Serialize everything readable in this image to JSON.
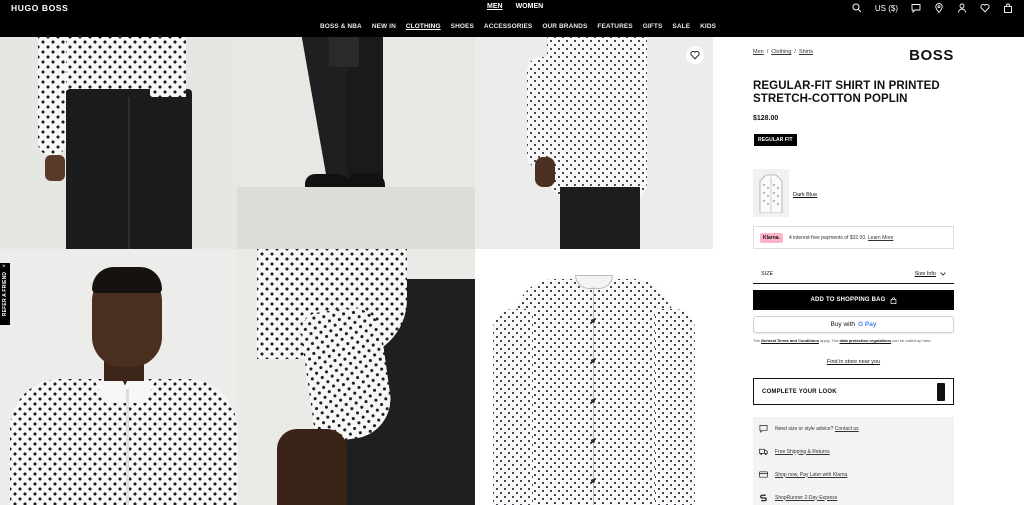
{
  "header": {
    "logo": "HUGO BOSS",
    "gender_tabs": [
      "MEN",
      "WOMEN"
    ],
    "nav": [
      "BOSS & NBA",
      "NEW IN",
      "CLOTHING",
      "SHOES",
      "ACCESSORIES",
      "OUR BRANDS",
      "FEATURES",
      "GIFTS",
      "SALE",
      "KIDS"
    ],
    "currency": "US ($)",
    "icons": [
      "search-icon",
      "chat-icon",
      "location-icon",
      "account-icon",
      "wishlist-icon",
      "bag-icon"
    ]
  },
  "refer_a_friend": "REFER A FRIEND",
  "product": {
    "breadcrumb": [
      "Men",
      "Clothing",
      "Shirts"
    ],
    "brand": "BOSS",
    "title": "REGULAR-FIT SHIRT IN PRINTED STRETCH-COTTON POPLIN",
    "price": "$128.00",
    "fit_badge": "REGULAR FIT",
    "color": "Dark Blue",
    "klarna": {
      "badge": "Klarna.",
      "text": "4 interest-free payments of $32.00.",
      "link": "Learn More"
    },
    "size_label": "SIZE",
    "size_info": "Size Info",
    "add_to_bag": "ADD TO SHOPPING BAG",
    "gpay_prefix": "Buy with",
    "gpay_brand": "G Pay",
    "legal": {
      "prefix": "The",
      "terms": "General Terms and Conditions",
      "middle": "apply. The",
      "privacy": "data protection regulations",
      "suffix": "can be called up here."
    },
    "find_in_store": "Find in store near you",
    "complete_look": "COMPLETE YOUR LOOK",
    "services": {
      "advice_text": "Need size or style advice?",
      "advice_link": "Contact us",
      "shipping": "Free Shipping & Returns",
      "klarna": "Shop now, Pay Later with Klarna",
      "shoprunner": "ShopRunner 2-Day Express"
    }
  },
  "colors": {
    "header_bg": "#000000",
    "klarna_pink": "#ffb3c7",
    "panel_bg": "#f3f3f3"
  }
}
